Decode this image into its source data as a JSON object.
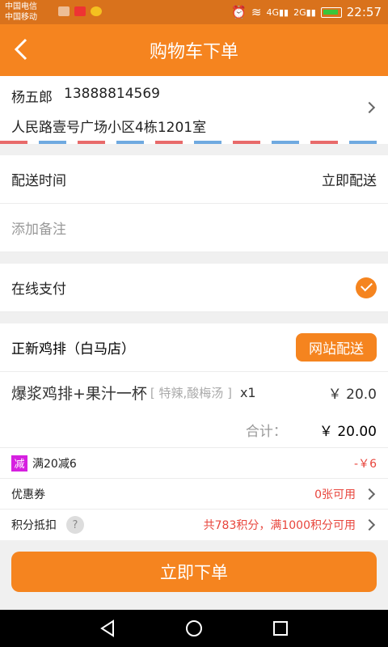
{
  "status_bar": {
    "carrier1": "中国电信",
    "carrier2": "中国移动",
    "time": "22:57"
  },
  "header": {
    "title": "购物车下单"
  },
  "address": {
    "name": "杨五郎",
    "phone": "13888814569",
    "detail": "人民路壹号广场小区4栋1201室"
  },
  "delivery": {
    "label": "配送时间",
    "value": "立即配送"
  },
  "note": {
    "placeholder": "添加备注"
  },
  "payment": {
    "label": "在线支付"
  },
  "shop": {
    "name": "正新鸡排（白马店）",
    "delivery_button": "网站配送"
  },
  "items": [
    {
      "name": "爆浆鸡排+果汁一杯",
      "spec": "[ 特辣,酸梅汤 ]",
      "qty": "x1",
      "price": "￥ 20.0"
    }
  ],
  "total": {
    "label": "合计：",
    "value": "￥ 20.00"
  },
  "discount": {
    "badge": "减",
    "label": "满20减6",
    "value": "-￥6"
  },
  "coupon": {
    "label": "优惠券",
    "value": "0张可用"
  },
  "points": {
    "label": "积分抵扣",
    "help": "?",
    "value": "共783积分，满1000积分可用"
  },
  "submit": {
    "label": "立即下单"
  },
  "colors": {
    "accent": "#f5841f",
    "status_bar": "#d9721c",
    "red": "#e8453c"
  }
}
